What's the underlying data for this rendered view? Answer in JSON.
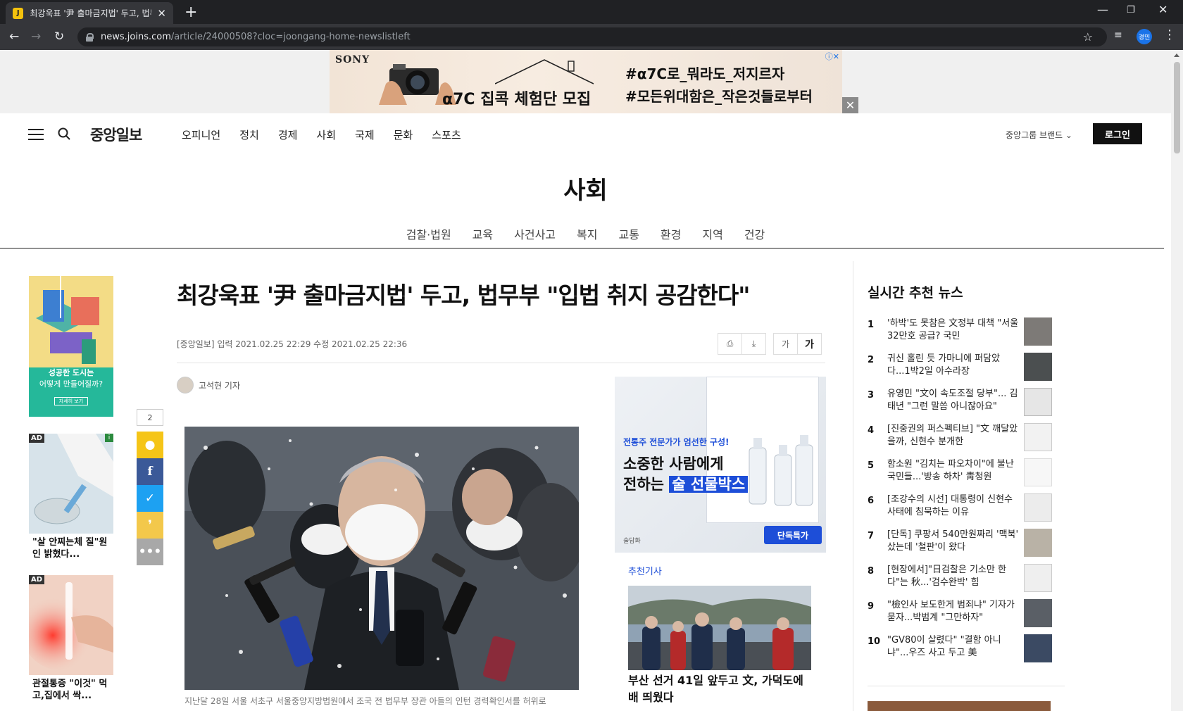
{
  "browser": {
    "tab_title": "최강욱표 '尹 출마금지법' 두고, 법무부 \"입법 취지 공감한다\" | 중앙일보",
    "tab_favicon_letter": "J",
    "url_host": "news.joins.com",
    "url_path": "/article/24000508?cloc=joongang-home-newslistleft",
    "profile_label": "경민"
  },
  "top_ad": {
    "brand": "SONY",
    "headline": "α7C 집콕 체험단 모집",
    "tag1": "#α7C로_뭐라도_저지르자",
    "tag2": "#모든위대함은_작은것들로부터",
    "close": "✕"
  },
  "header": {
    "logo": "중앙일보",
    "nav": [
      "오피니언",
      "정치",
      "경제",
      "사회",
      "국제",
      "문화",
      "스포츠"
    ],
    "brand_menu": "중앙그룹 브랜드 ⌄",
    "login": "로그인"
  },
  "section": {
    "title": "사회",
    "subnav": [
      "검찰·법원",
      "교육",
      "사건사고",
      "복지",
      "교통",
      "환경",
      "지역",
      "건강"
    ]
  },
  "left_rail": {
    "ad1_line1": "성공한 도시는",
    "ad1_line2": "어떻게 만들어질까?",
    "ad1_btn": "자세히 보기",
    "ad_badge": "AD",
    "ad_i": "i",
    "ad2_caption": "\"살 안찌는체 질\"원인 밝혔다...",
    "ad3_caption": "관절통증 \"이것\" 먹고,집에서 싹..."
  },
  "share": {
    "count": "2"
  },
  "article": {
    "headline": "최강욱표 '尹 출마금지법' 두고, 법무부 \"입법 취지 공감한다\"",
    "meta": "[중앙일보] 입력 2021.02.25 22:29   수정 2021.02.25 22:36",
    "font_small": "가",
    "font_big": "가",
    "reporter": "고석현 기자",
    "caption": "지난달 28일 서울 서초구 서울중앙지방법원에서 조국 전 법무부 장관 아들의 인턴 경력확인서를 허위로"
  },
  "promo": {
    "kicker": "전통주 전문가가 엄선한 구성!",
    "line1": "소중한 사람에게",
    "line2_prefix": "전하는 ",
    "line2_highlight": "술 선물박스",
    "deal": "단독특가",
    "logo": "술담화"
  },
  "recommended": {
    "label": "추천기사",
    "title": "부산 선거 41일 앞두고 文, 가덕도에 배 띄웠다"
  },
  "realtime": {
    "title": "실시간 추천 뉴스",
    "items": [
      {
        "num": "1",
        "text": "'하박'도 못참은 文정부 대책 \"서울 32만호 공급? 국민"
      },
      {
        "num": "2",
        "text": "귀신 홀린 듯 가마니에 퍼담았다...1박2일 아수라장"
      },
      {
        "num": "3",
        "text": "유영민 \"文이 속도조절 당부\"... 김태년 \"그런 말씀 아니잖아요\""
      },
      {
        "num": "4",
        "text": "[진중권의 퍼스펙티브] \"文 깨달았을까, 신현수 분개한"
      },
      {
        "num": "5",
        "text": "함소원 \"김치는 파오차이\"에 불난 국민들...'방송 하차' 靑청원"
      },
      {
        "num": "6",
        "text": "[조강수의 시선] 대통령이 신현수 사태에 침묵하는 이유"
      },
      {
        "num": "7",
        "text": "[단독] 쿠팡서 540만원짜리 '맥북' 샀는데 '철판'이 왔다"
      },
      {
        "num": "8",
        "text": "[현장에서]\"日검찰은 기소만 한다\"는 秋...'검수완박' 힘"
      },
      {
        "num": "9",
        "text": "\"檢인사 보도한게 범죄냐\" 기자가 묻자...박범계 \"그만하자\""
      },
      {
        "num": "10",
        "text": "\"GV80이 살렸다\" \"결함 아니냐\"...우즈 사고 두고 美"
      }
    ]
  }
}
